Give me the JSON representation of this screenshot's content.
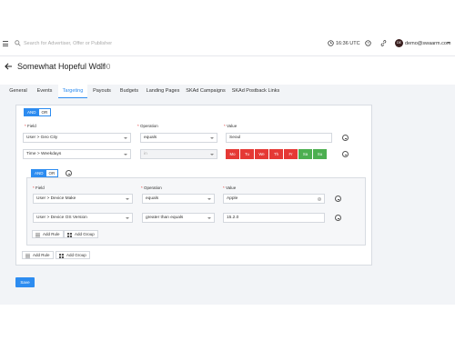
{
  "topbar": {
    "search_placeholder": "Search for Advertiser, Offer or Publisher",
    "time": "16:36 UTC",
    "avatar_initials": "DE",
    "user_email": "demo@swaarm.com"
  },
  "page": {
    "title": "Somewhat Hopeful Wolf",
    "id": "990"
  },
  "tabs": [
    "General",
    "Events",
    "Targeting",
    "Payouts",
    "Budgets",
    "Landing Pages",
    "SKAd Campaigns",
    "SKAd Postback Links"
  ],
  "active_tab": "Targeting",
  "rules": {
    "and_label": "AND",
    "or_label": "OR",
    "labels": {
      "field": "Field",
      "operation": "Operation",
      "value": "Value"
    },
    "rows": [
      {
        "field": "User > Geo City",
        "operation": "equals",
        "value": "Seoul"
      },
      {
        "field": "Time > Weekdays",
        "operation": "in",
        "value": ""
      }
    ],
    "weekdays": [
      {
        "label": "Mo",
        "color": "#e53935"
      },
      {
        "label": "Tu",
        "color": "#e53935"
      },
      {
        "label": "We",
        "color": "#e53935"
      },
      {
        "label": "Th",
        "color": "#e53935"
      },
      {
        "label": "Fr",
        "color": "#e53935"
      },
      {
        "label": "Sa",
        "color": "#4caf50"
      },
      {
        "label": "Su",
        "color": "#4caf50"
      }
    ],
    "subgroup": {
      "and_label": "AND",
      "or_label": "OR",
      "rows": [
        {
          "field": "User > Device Make",
          "operation": "equals",
          "value": "Apple"
        },
        {
          "field": "User > Device OS Version",
          "operation": "greater than equals",
          "value": "15.2.0"
        }
      ],
      "add_rule": "Add Rule",
      "add_group": "Add Group"
    },
    "add_rule": "Add Rule",
    "add_group": "Add Group"
  },
  "save_label": "Save",
  "colors": {
    "accent": "#2d8cf0",
    "danger": "#e53935",
    "success": "#4caf50"
  }
}
